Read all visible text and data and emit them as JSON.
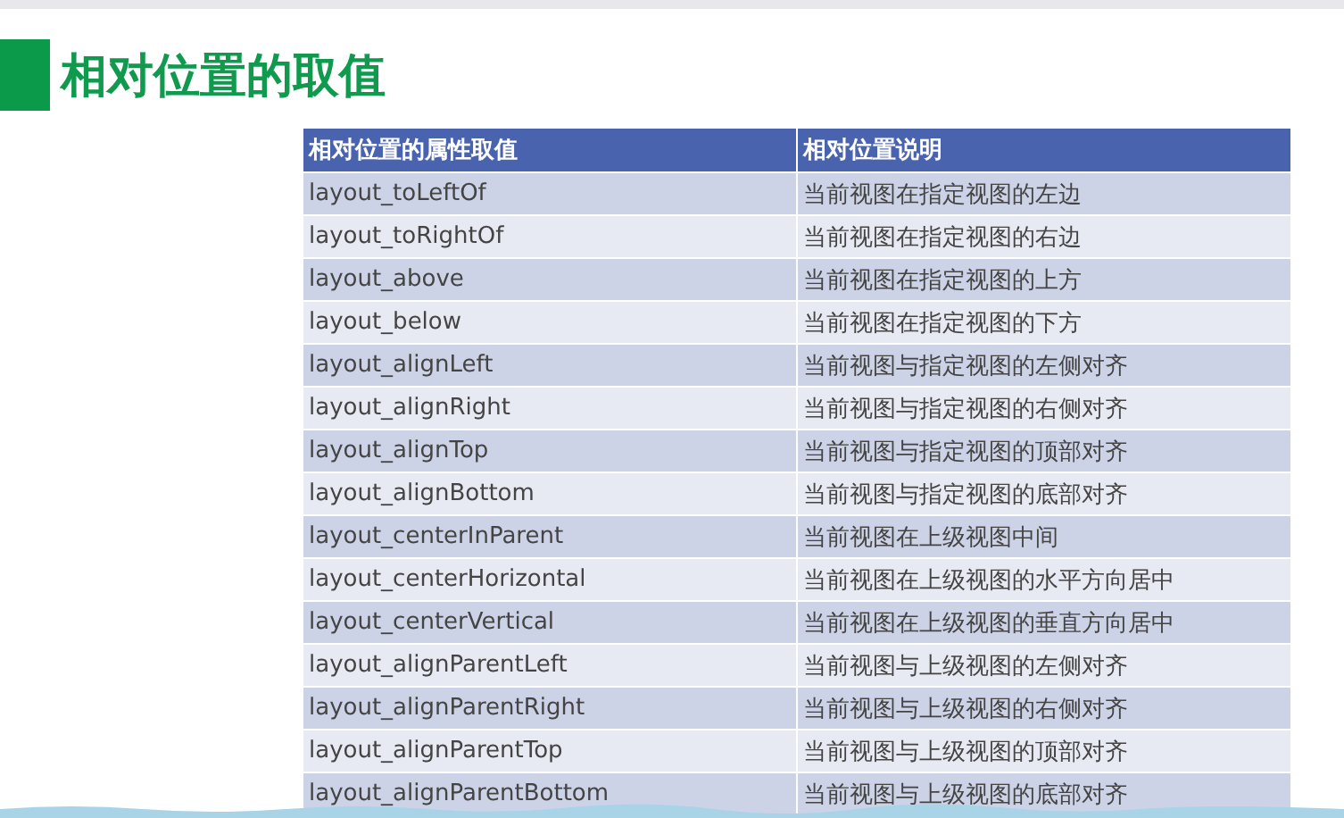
{
  "slide": {
    "title": "相对位置的取值",
    "table": {
      "columns": [
        "相对位置的属性取值",
        "相对位置说明"
      ],
      "rows": [
        [
          "layout_toLeftOf",
          "当前视图在指定视图的左边"
        ],
        [
          "layout_toRightOf",
          "当前视图在指定视图的右边"
        ],
        [
          "layout_above",
          "当前视图在指定视图的上方"
        ],
        [
          "layout_below",
          "当前视图在指定视图的下方"
        ],
        [
          "layout_alignLeft",
          "当前视图与指定视图的左侧对齐"
        ],
        [
          "layout_alignRight",
          "当前视图与指定视图的右侧对齐"
        ],
        [
          "layout_alignTop",
          "当前视图与指定视图的顶部对齐"
        ],
        [
          "layout_alignBottom",
          "当前视图与指定视图的底部对齐"
        ],
        [
          "layout_centerInParent",
          "当前视图在上级视图中间"
        ],
        [
          "layout_centerHorizontal",
          "当前视图在上级视图的水平方向居中"
        ],
        [
          "layout_centerVertical",
          "当前视图在上级视图的垂直方向居中"
        ],
        [
          "layout_alignParentLeft",
          "当前视图与上级视图的左侧对齐"
        ],
        [
          "layout_alignParentRight",
          "当前视图与上级视图的右侧对齐"
        ],
        [
          "layout_alignParentTop",
          "当前视图与上级视图的顶部对齐"
        ],
        [
          "layout_alignParentBottom",
          "当前视图与上级视图的底部对齐"
        ]
      ]
    }
  }
}
